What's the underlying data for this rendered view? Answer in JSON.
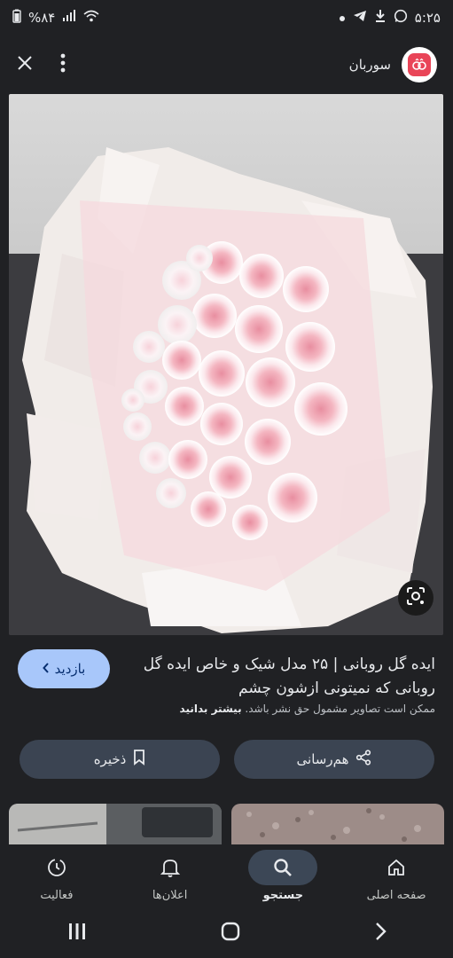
{
  "status_bar": {
    "time": "۵:۲۵",
    "battery": "%۸۴"
  },
  "top_bar": {
    "source_name": "سوربان"
  },
  "result": {
    "title": "ایده گل روبانی | ۲۵ مدل شیک و خاص ایده گل روبانی که نمیتونی ازشون چشم",
    "visit_label": "بازدید",
    "copyright_text": "ممکن است تصاویر مشمول حق نشر باشد.",
    "learn_more": "بیشتر بدانید",
    "share_label": "هم‌رسانی",
    "save_label": "ذخیره"
  },
  "bottom_nav": {
    "items": [
      {
        "label": "فعالیت",
        "icon": "activity-icon"
      },
      {
        "label": "اعلان‌ها",
        "icon": "bell-icon"
      },
      {
        "label": "جستجو",
        "icon": "search-icon"
      },
      {
        "label": "صفحه اصلی",
        "icon": "home-icon"
      }
    ],
    "active": "جستجو"
  },
  "colors": {
    "background": "#202124",
    "accent": "#a8c7fa",
    "button": "#3b4452"
  }
}
